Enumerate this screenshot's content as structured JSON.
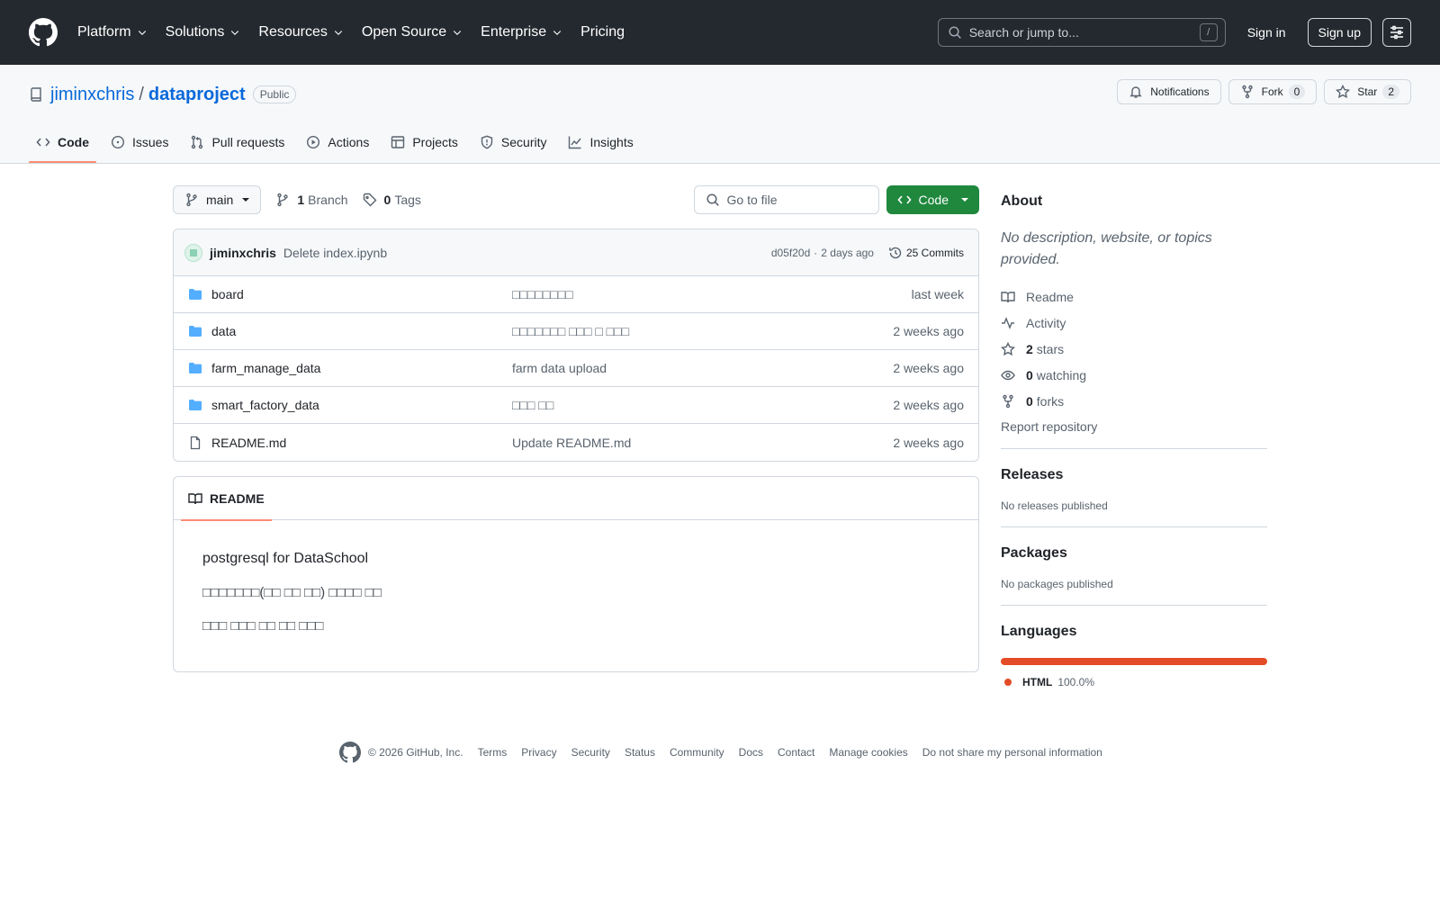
{
  "colors": {
    "header_bg": "#24292f",
    "accent_link": "#0969da",
    "primary_button": "#1f883d",
    "active_tab_underline": "#fd8c73",
    "folder_icon": "#54aeff",
    "html_language": "#e34c26"
  },
  "header": {
    "nav": [
      {
        "label": "Platform",
        "dropdown": true
      },
      {
        "label": "Solutions",
        "dropdown": true
      },
      {
        "label": "Resources",
        "dropdown": true
      },
      {
        "label": "Open Source",
        "dropdown": true
      },
      {
        "label": "Enterprise",
        "dropdown": true
      },
      {
        "label": "Pricing",
        "dropdown": false
      }
    ],
    "search_placeholder": "Search or jump to...",
    "search_shortcut": "/",
    "sign_in": "Sign in",
    "sign_up": "Sign up"
  },
  "repo": {
    "owner": "jiminxchris",
    "separator": "/",
    "name": "dataproject",
    "visibility": "Public",
    "notifications_label": "Notifications",
    "fork_label": "Fork",
    "fork_count": "0",
    "star_label": "Star",
    "star_count": "2",
    "tabs": [
      {
        "label": "Code",
        "icon": "code-icon",
        "active": true
      },
      {
        "label": "Issues",
        "icon": "issue-icon",
        "active": false
      },
      {
        "label": "Pull requests",
        "icon": "pull-request-icon",
        "active": false
      },
      {
        "label": "Actions",
        "icon": "play-icon",
        "active": false
      },
      {
        "label": "Projects",
        "icon": "table-icon",
        "active": false
      },
      {
        "label": "Security",
        "icon": "shield-icon",
        "active": false
      },
      {
        "label": "Insights",
        "icon": "graph-icon",
        "active": false
      }
    ]
  },
  "toolbar": {
    "branch": "main",
    "branch_count": "1",
    "branch_word": "Branch",
    "tag_count": "0",
    "tag_word": "Tags",
    "goto_placeholder": "Go to file",
    "code_button": "Code"
  },
  "commit": {
    "author": "jiminxchris",
    "message": "Delete index.ipynb",
    "hash": "d05f20d",
    "dot": "·",
    "age": "2 days ago",
    "commits_label": "25 Commits"
  },
  "files": [
    {
      "name": "board",
      "type": "folder",
      "message": "□□□□□□□□",
      "date": "last week"
    },
    {
      "name": "data",
      "type": "folder",
      "message": "□□□□□□□ □□□ □ □□□",
      "date": "2 weeks ago"
    },
    {
      "name": "farm_manage_data",
      "type": "folder",
      "message": "farm data upload",
      "date": "2 weeks ago"
    },
    {
      "name": "smart_factory_data",
      "type": "folder",
      "message": "□□□ □□",
      "date": "2 weeks ago"
    },
    {
      "name": "README.md",
      "type": "file",
      "message": "Update README.md",
      "date": "2 weeks ago"
    }
  ],
  "readme": {
    "tab_label": "README",
    "lines": [
      "postgresql for DataSchool",
      "□□□□□□□(□□ □□ □□) □□□□ □□",
      "□□□ □□□ □□ □□ □□□"
    ]
  },
  "sidebar": {
    "about_title": "About",
    "about_desc": "No description, website, or topics provided.",
    "readme": "Readme",
    "activity": "Activity",
    "stars_count": "2",
    "stars_word": "stars",
    "watching_count": "0",
    "watching_word": "watching",
    "forks_count": "0",
    "forks_word": "forks",
    "report": "Report repository",
    "releases_title": "Releases",
    "releases_sub": "No releases published",
    "packages_title": "Packages",
    "packages_sub": "No packages published",
    "languages_title": "Languages",
    "language_name": "HTML",
    "language_pct": "100.0%",
    "language_share": 1.0
  },
  "footer": {
    "copyright": "© 2026 GitHub, Inc.",
    "links": [
      "Terms",
      "Privacy",
      "Security",
      "Status",
      "Community",
      "Docs",
      "Contact",
      "Manage cookies",
      "Do not share my personal information"
    ]
  }
}
